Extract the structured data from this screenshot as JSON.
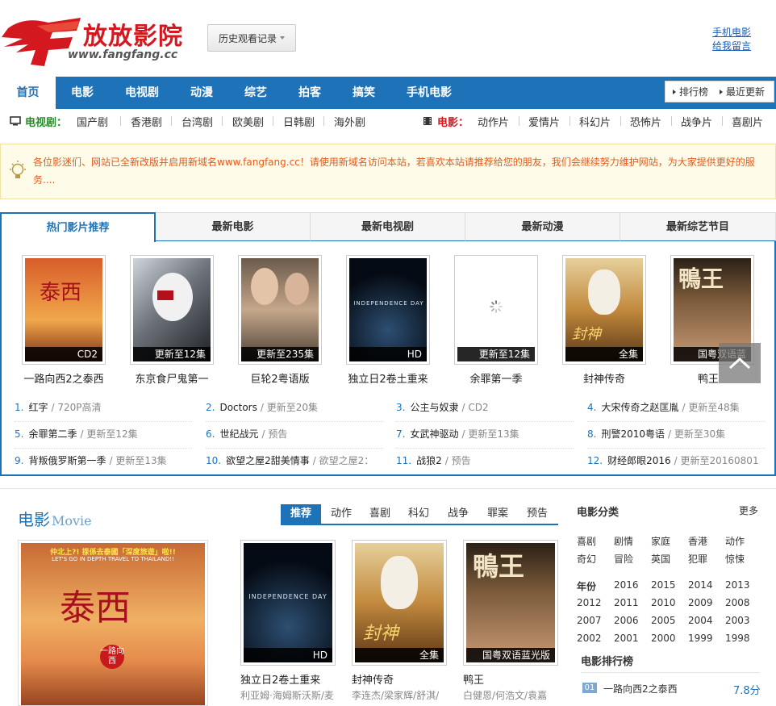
{
  "header": {
    "logo_text": "放放影院",
    "logo_domain": "www.fangfang.cc",
    "history_button": "历史观看记录",
    "mobile_link": "手机电影",
    "message_link": "给我留言"
  },
  "nav": {
    "items": [
      "首页",
      "电影",
      "电视剧",
      "动漫",
      "综艺",
      "拍客",
      "搞笑",
      "手机电影"
    ],
    "ranking": "排行榜",
    "latest": "最近更新"
  },
  "subnav": {
    "tv_label": "电视剧：",
    "tv_items": [
      "国产剧",
      "香港剧",
      "台湾剧",
      "欧美剧",
      "日韩剧",
      "海外剧"
    ],
    "movie_label": "电影：",
    "movie_items": [
      "动作片",
      "爱情片",
      "科幻片",
      "恐怖片",
      "战争片",
      "喜剧片"
    ]
  },
  "notice": "各位影迷们、网站已全新改版并启用新域名www.fangfang.cc！请使用新域名访问本站，若喜欢本站请推荐给您的朋友，我们会继续努力维护网站，为大家提供更好的服务....",
  "hot": {
    "tabs": [
      "热门影片推荐",
      "最新电影",
      "最新电视剧",
      "最新动漫",
      "最新综艺节目"
    ],
    "posters": [
      {
        "title": "一路向西2之泰西",
        "badge": "CD2"
      },
      {
        "title": "东京食尸鬼第一",
        "badge": "更新至12集"
      },
      {
        "title": "巨轮2粤语版",
        "badge": "更新至235集"
      },
      {
        "title": "独立日2卷土重来",
        "badge": "HD"
      },
      {
        "title": "余罪第一季",
        "badge": "更新至12集"
      },
      {
        "title": "封神传奇",
        "badge": "全集"
      },
      {
        "title": "鸭王",
        "badge": "国粤双语蓝"
      }
    ],
    "poster_art": {
      "p4_text": "INDEPENDENCE DAY",
      "p6_text": "封神",
      "p7_text": "鴨王"
    },
    "ranks": [
      {
        "num": "1.",
        "title": "红字",
        "meta": "/ 720P高清"
      },
      {
        "num": "2.",
        "title": "Doctors",
        "meta": "/ 更新至20集"
      },
      {
        "num": "3.",
        "title": "公主与奴隶",
        "meta": "/ CD2"
      },
      {
        "num": "4.",
        "title": "大宋传奇之赵匡胤",
        "meta": "/ 更新至48集"
      },
      {
        "num": "5.",
        "title": "余罪第二季",
        "meta": "/ 更新至12集"
      },
      {
        "num": "6.",
        "title": "世纪战元",
        "meta": "/ 预告"
      },
      {
        "num": "7.",
        "title": "女武神驱动",
        "meta": "/ 更新至13集"
      },
      {
        "num": "8.",
        "title": "刑警2010粤语",
        "meta": "/ 更新至30集"
      },
      {
        "num": "9.",
        "title": "背叛俄罗斯第一季",
        "meta": "/ 更新至13集"
      },
      {
        "num": "10.",
        "title": "欲望之屋2甜美情事",
        "meta": "/ 欲望之屋2："
      },
      {
        "num": "11.",
        "title": "战狼2",
        "meta": "/ 预告"
      },
      {
        "num": "12.",
        "title": "财经郎眼2016",
        "meta": "/ 更新至20160801"
      }
    ]
  },
  "movie": {
    "title": "电影",
    "title_en": "Movie",
    "tabs": [
      "推荐",
      "动作",
      "喜剧",
      "科幻",
      "战争",
      "罪案",
      "预告"
    ],
    "big_poster_text": "泰西",
    "big_poster_tagline": "LET'S GO IN DEPTH TRAVEL TO THAILAND!!",
    "big_poster_hook": "仲北上?! 揼係去泰國「深度旅遊」啦!!",
    "big_poster_badge": "一路向西",
    "items": [
      {
        "title": "独立日2卷土重来",
        "badge": "HD",
        "cast": "利亚姆·海姆斯沃斯/麦"
      },
      {
        "title": "封神传奇",
        "badge": "全集",
        "cast": "李连杰/梁家辉/舒淇/"
      },
      {
        "title": "鸭王",
        "badge": "国粤双语蓝光版",
        "cast": "白健恩/何浩文/袁嘉"
      }
    ]
  },
  "sidebar": {
    "category_title": "电影分类",
    "more": "更多",
    "genres": [
      "喜剧",
      "剧情",
      "家庭",
      "香港",
      "动作",
      "奇幻",
      "冒险",
      "英国",
      "犯罪",
      "惊悚"
    ],
    "year_label": "年份",
    "years": [
      "2016",
      "2015",
      "2014",
      "2013",
      "2012",
      "2011",
      "2010",
      "2009",
      "2008",
      "2007",
      "2006",
      "2005",
      "2004",
      "2003",
      "2002",
      "2001",
      "2000",
      "1999",
      "1998"
    ],
    "rank_title": "电影排行榜",
    "rank_first": {
      "num": "01",
      "title": "一路向西2之泰西",
      "score": "7.8分"
    }
  }
}
